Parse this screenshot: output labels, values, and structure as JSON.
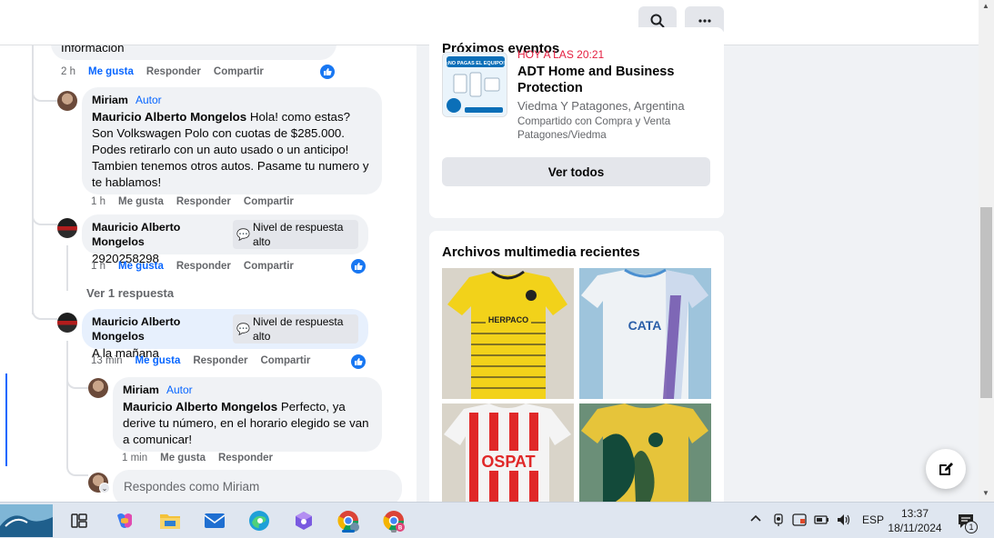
{
  "topbar": {
    "search_icon": "search-icon",
    "more_icon": "more-horizontal-icon"
  },
  "comments": {
    "prev_tail_text": "Información",
    "prev_actions": {
      "time": "2 h",
      "like": "Me gusta",
      "reply": "Responder",
      "share": "Compartir"
    },
    "items": [
      {
        "author": "Miriam",
        "tag": "Autor",
        "mention": "Mauricio Alberto Mongelos",
        "text": "Hola! como estas? Son Volkswagen Polo con cuotas de $285.000. Podes retirarlo con un auto usado o un anticipo! Tambien tenemos otros autos. Pasame tu numero y te hablamos!",
        "time": "1 h",
        "like": "Me gusta",
        "reply": "Responder",
        "share": "Compartir"
      },
      {
        "author": "Mauricio Alberto Mongelos",
        "badge": "Nivel de respuesta alto",
        "text": "2920258298",
        "time": "1 h",
        "like": "Me gusta",
        "reply": "Responder",
        "share": "Compartir"
      },
      {
        "author": "Mauricio Alberto Mongelos",
        "badge": "Nivel de respuesta alto",
        "text": "A la mañana",
        "time": "13 min",
        "like": "Me gusta",
        "reply": "Responder",
        "share": "Compartir"
      },
      {
        "author": "Miriam",
        "tag": "Autor",
        "mention": "Mauricio Alberto Mongelos",
        "text": "Perfecto, ya derive tu número, en el horario elegido se van a comunicar!",
        "time": "1 min",
        "like": "Me gusta",
        "reply": "Responder"
      }
    ],
    "view_replies": "Ver 1 respuesta",
    "reply_placeholder": "Respondes como Miriam"
  },
  "events_card": {
    "title": "Próximos eventos",
    "when": "HOY A LAS 20:21",
    "name": "ADT Home and Business Protection",
    "place": "Viedma Y Patagones, Argentina",
    "shared": "Compartido con Compra y Venta Patagones/Viedma",
    "see_all": "Ver todos",
    "thumb_text": "¡NO PAGAS EL EQUIPO!"
  },
  "media_card": {
    "title": "Archivos multimedia recientes",
    "items": [
      {
        "name": "yellow-jersey-photo",
        "brand": "HERPACO"
      },
      {
        "name": "white-blue-jersey-photo",
        "brand": "CATA"
      },
      {
        "name": "red-white-jersey-photo",
        "brand": "OSPAT"
      },
      {
        "name": "yellow-green-jersey-photo",
        "brand": ""
      }
    ]
  },
  "taskbar": {
    "lang": "ESP",
    "time": "13:37",
    "date": "18/11/2024",
    "notification_count": "1",
    "browser_badge": "B"
  },
  "colors": {
    "accent": "#0866ff",
    "like": "#1877f2",
    "event_red": "#e41e3f",
    "muted": "#65676b"
  }
}
